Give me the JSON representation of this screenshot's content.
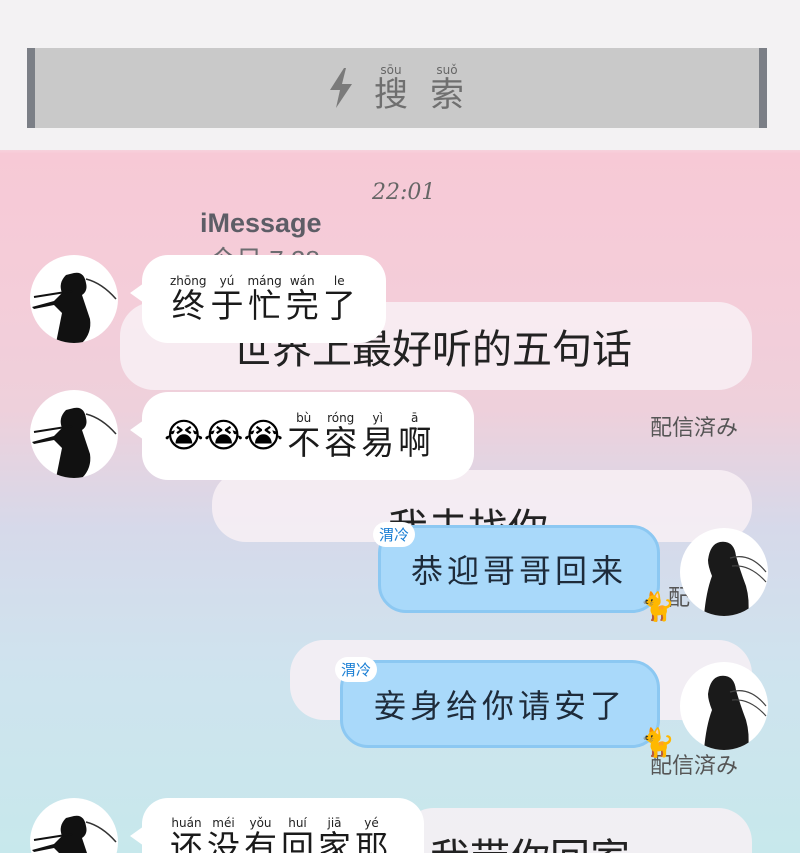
{
  "search": {
    "label_chars": [
      {
        "pinyin": "sōu",
        "hanzi": "搜"
      },
      {
        "pinyin": "suǒ",
        "hanzi": "索"
      }
    ],
    "icon": "lightning-icon"
  },
  "background_imessage": {
    "time": "22:01",
    "service": "iMessage",
    "date_partial": "今日 7:28",
    "bubble_1": "世界上最好听的五句话",
    "status_1": "配信済み",
    "bubble_2": "我去找你",
    "status_2_partial": "配",
    "status_3": "配信済み",
    "bubble_3": "我带你回家"
  },
  "messages": [
    {
      "side": "left",
      "chars": [
        {
          "pinyin": "zhōng",
          "hanzi": "终"
        },
        {
          "pinyin": "yú",
          "hanzi": "于"
        },
        {
          "pinyin": "máng",
          "hanzi": "忙"
        },
        {
          "pinyin": "wán",
          "hanzi": "完"
        },
        {
          "pinyin": "le",
          "hanzi": "了"
        }
      ]
    },
    {
      "side": "left",
      "emoji": "😭😭😭",
      "chars": [
        {
          "pinyin": "bù",
          "hanzi": "不"
        },
        {
          "pinyin": "róng",
          "hanzi": "容"
        },
        {
          "pinyin": "yì",
          "hanzi": "易"
        },
        {
          "pinyin": "ā",
          "hanzi": "啊"
        }
      ]
    },
    {
      "side": "right",
      "badge": "渭冷",
      "text": "恭迎哥哥回来"
    },
    {
      "side": "right",
      "badge": "渭冷",
      "text": "妾身给你请安了"
    },
    {
      "side": "left",
      "chars": [
        {
          "pinyin": "huán",
          "hanzi": "还"
        },
        {
          "pinyin": "méi",
          "hanzi": "没"
        },
        {
          "pinyin": "yǒu",
          "hanzi": "有"
        },
        {
          "pinyin": "huí",
          "hanzi": "回"
        },
        {
          "pinyin": "jiā",
          "hanzi": "家"
        },
        {
          "pinyin": "yé",
          "hanzi": "耶"
        }
      ]
    }
  ],
  "colors": {
    "blue_bubble": "#a9d9fa",
    "white_bubble": "#ffffff"
  }
}
